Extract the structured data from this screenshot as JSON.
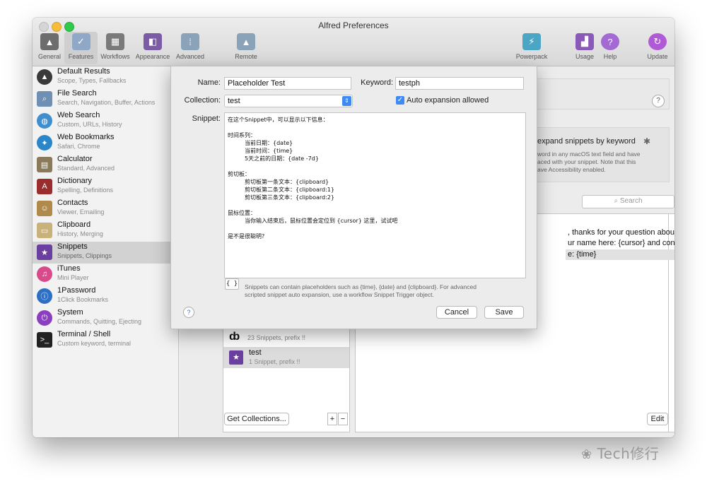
{
  "window": {
    "title": "Alfred Preferences"
  },
  "toolbar": {
    "tabs": [
      {
        "label": "General",
        "icon": "hat-icon",
        "color": "#6d6d6d"
      },
      {
        "label": "Features",
        "icon": "checkbox-icon",
        "color": "#8fa8c7"
      },
      {
        "label": "Workflows",
        "icon": "workflow-grid-icon",
        "color": "#7a7a7a"
      },
      {
        "label": "Appearance",
        "icon": "appearance-icon",
        "color": "#7b5aa6"
      },
      {
        "label": "Advanced",
        "icon": "advanced-icon",
        "color": "#8aa3b8"
      },
      {
        "label": "Remote",
        "icon": "remote-icon",
        "color": "#8aa3b8"
      },
      {
        "label": "Powerpack",
        "icon": "battery-icon",
        "color": "#4aa6c4"
      },
      {
        "label": "Usage",
        "icon": "chart-icon",
        "color": "#8a5ab8"
      },
      {
        "label": "Help",
        "icon": "help-icon",
        "color": "#a36ad3"
      },
      {
        "label": "Update",
        "icon": "update-icon",
        "color": "#b05ad6"
      }
    ]
  },
  "sidebar": {
    "items": [
      {
        "title": "Default Results",
        "sub": "Scope, Types, Fallbacks",
        "icon": "hat-icon",
        "color": "#3a3a3a"
      },
      {
        "title": "File Search",
        "sub": "Search, Navigation, Buffer, Actions",
        "icon": "magnifier-icon",
        "color": "#6f8fb5"
      },
      {
        "title": "Web Search",
        "sub": "Custom, URLs, History",
        "icon": "globe-icon",
        "color": "#3f8fcf"
      },
      {
        "title": "Web Bookmarks",
        "sub": "Safari, Chrome",
        "icon": "compass-icon",
        "color": "#2a86c8"
      },
      {
        "title": "Calculator",
        "sub": "Standard, Advanced",
        "icon": "calculator-icon",
        "color": "#8a7a5a"
      },
      {
        "title": "Dictionary",
        "sub": "Spelling, Definitions",
        "icon": "dictionary-icon",
        "color": "#9b2d2d"
      },
      {
        "title": "Contacts",
        "sub": "Viewer, Emailing",
        "icon": "contacts-icon",
        "color": "#b08a4a"
      },
      {
        "title": "Clipboard",
        "sub": "History, Merging",
        "icon": "clipboard-icon",
        "color": "#c9b27a"
      },
      {
        "title": "Snippets",
        "sub": "Snippets, Clippings",
        "icon": "snippets-star-icon",
        "color": "#6a3fa0"
      },
      {
        "title": "iTunes",
        "sub": "Mini Player",
        "icon": "itunes-icon",
        "color": "#d94a8a"
      },
      {
        "title": "1Password",
        "sub": "1Click Bookmarks",
        "icon": "onepassword-icon",
        "color": "#2c6fc4"
      },
      {
        "title": "System",
        "sub": "Commands, Quitting, Ejecting",
        "icon": "power-icon",
        "color": "#8a3fc0"
      },
      {
        "title": "Terminal / Shell",
        "sub": "Custom keyword, terminal",
        "icon": "terminal-icon",
        "color": "#222222"
      }
    ],
    "selected_index": 8
  },
  "main": {
    "help_glyph": "?",
    "promo_title": "expand snippets by keyword",
    "promo_text": [
      "word in any macOS text field and have",
      "aced with your snippet. Note that this",
      "ave Accessibility enabled."
    ],
    "search_placeholder": "Search",
    "snippet_rows": [
      ", thanks for your question about {...",
      "ur name here: {cursor} and config...",
      "e: {time}"
    ],
    "collections": [
      {
        "title": "",
        "sub": "23 Snippets, prefix !!",
        "icon": "snippet-group-icon"
      },
      {
        "title": "test",
        "sub": "1 Snippet, prefix !!",
        "icon": "snippets-star-icon"
      }
    ],
    "get_collections_label": "Get Collections...",
    "plus_glyph": "+",
    "minus_glyph": "−",
    "edit_label": "Edit"
  },
  "sheet": {
    "name_label": "Name:",
    "name_value": "Placeholder Test",
    "keyword_label": "Keyword:",
    "keyword_value": "testph",
    "collection_label": "Collection:",
    "collection_value": "test",
    "auto_expansion_label": "Auto expansion allowed",
    "auto_expansion_checked": true,
    "snippet_label": "Snippet:",
    "snippet_lines": [
      "在这个Snippet中，可以显示以下信息：",
      "时间系列：",
      "当前日期：{date}",
      "当前时间：{time}",
      "5天之前的日期：{date -7d}",
      "剪切板：",
      "剪切板第一条文本：{clipboard}",
      "剪切板第二条文本：{clipboard:1}",
      "剪切板第三条文本：{clipboard:2}",
      "鼠标位置：",
      "当你输入结束后，鼠标位置会定位到 {cursor} 这里，试试吧",
      "是不是很聪明?"
    ],
    "placeholder_button": "{ }",
    "hint_line1": "Snippets can contain placeholders such as {time}, {date} and {clipboard}. For advanced",
    "hint_line2": "scripted snippet auto expansion, use a workflow Snippet Trigger object.",
    "help_glyph": "?",
    "cancel_label": "Cancel",
    "save_label": "Save"
  },
  "watermark": "Tech修行"
}
